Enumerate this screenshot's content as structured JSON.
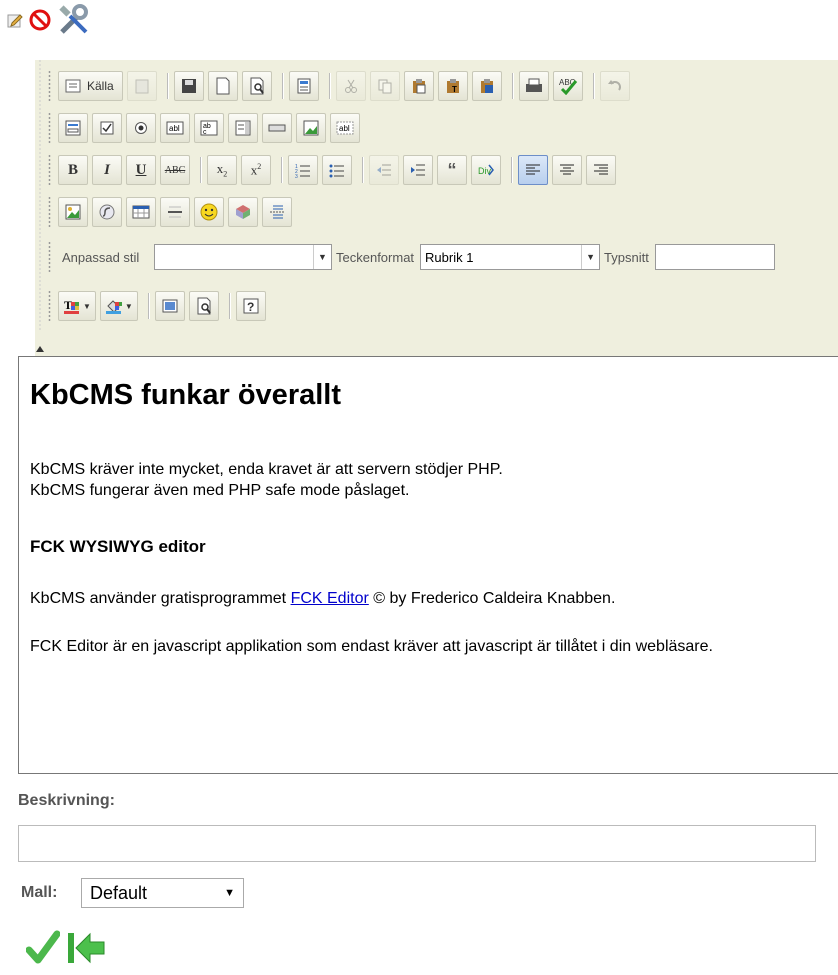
{
  "toolbar": {
    "source_label": "Källa",
    "style_label": "Anpassad stil",
    "style_value": "",
    "format_label": "Teckenformat",
    "format_value": "Rubrik 1",
    "font_label": "Typsnitt",
    "font_value": ""
  },
  "content": {
    "heading": "KbCMS funkar överallt",
    "para1_line1": "KbCMS kräver inte mycket, enda kravet är att servern stödjer PHP.",
    "para1_line2": "KbCMS fungerar även med PHP safe mode påslaget.",
    "subheading": "FCK WYSIWYG editor",
    "para2_prefix": "KbCMS använder gratisprogrammet ",
    "para2_link": "FCK Editor",
    "para2_suffix": " © by Frederico Caldeira Knabben.",
    "para3": "FCK Editor är en javascript applikation som endast kräver att javascript är tillåtet i din webläsare."
  },
  "form": {
    "description_label": "Beskrivning:",
    "description_value": "",
    "template_label": "Mall:",
    "template_value": "Default"
  }
}
